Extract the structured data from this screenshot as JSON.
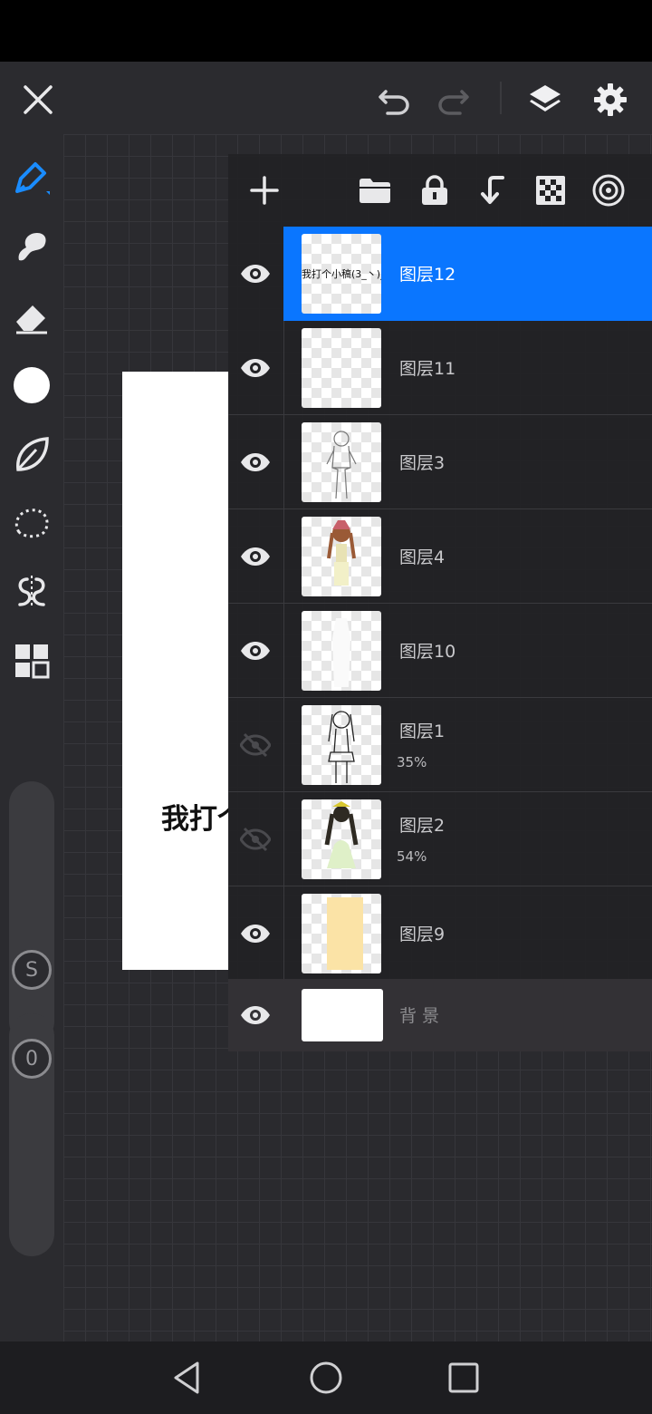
{
  "colors": {
    "accent": "#0a76ff",
    "toolbar": "#2b2b2f",
    "panel": "#222225"
  },
  "appbar": {
    "icons": [
      "close-icon",
      "undo-icon",
      "redo-icon",
      "layers-icon",
      "gear-icon"
    ]
  },
  "toolbar": {
    "tools": [
      "pen-icon",
      "smudge-icon",
      "eraser-icon",
      "color-icon",
      "leaf-icon",
      "lasso-icon",
      "symmetry-icon",
      "grid-icon"
    ],
    "size_knob": "S",
    "opacity_knob": "0"
  },
  "canvas": {
    "text": "我打个小稿"
  },
  "layers_panel": {
    "header_icons": [
      "add-icon",
      "folder-icon",
      "lock-icon",
      "merge-down-icon",
      "transparency-icon",
      "target-icon"
    ],
    "layers": [
      {
        "name": "图层12",
        "visible": true,
        "selected": true,
        "opacity": "",
        "thumb_text": "我打个小稿(3_丶)_"
      },
      {
        "name": "图层11",
        "visible": true,
        "selected": false,
        "opacity": ""
      },
      {
        "name": "图层3",
        "visible": true,
        "selected": false,
        "opacity": ""
      },
      {
        "name": "图层4",
        "visible": true,
        "selected": false,
        "opacity": ""
      },
      {
        "name": "图层10",
        "visible": true,
        "selected": false,
        "opacity": ""
      },
      {
        "name": "图层1",
        "visible": false,
        "selected": false,
        "opacity": "35%"
      },
      {
        "name": "图层2",
        "visible": false,
        "selected": false,
        "opacity": "54%"
      },
      {
        "name": "图层9",
        "visible": true,
        "selected": false,
        "opacity": ""
      }
    ],
    "background": {
      "name": "背景"
    }
  }
}
